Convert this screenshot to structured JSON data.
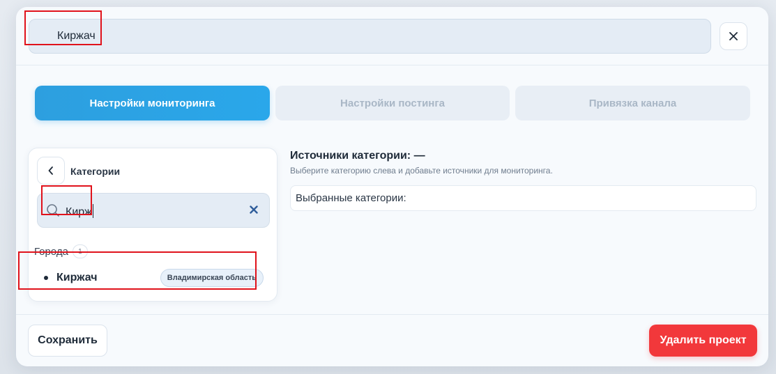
{
  "project": {
    "name": "Киржач"
  },
  "tabs": [
    {
      "label": "Настройки мониторинга",
      "active": true
    },
    {
      "label": "Настройки постинга",
      "active": false
    },
    {
      "label": "Привязка канала",
      "active": false
    }
  ],
  "categories_panel": {
    "title": "Категории",
    "search": {
      "value": "Кирж"
    },
    "group": {
      "label": "Города",
      "count": "1"
    },
    "results": [
      {
        "name": "Киржач",
        "region": "Владимирская область"
      }
    ]
  },
  "sources": {
    "title": "Источники категории: —",
    "description": "Выберите категорию слева и добавьте источники для мониторинга.",
    "selected_label": "Выбранные категории:"
  },
  "footer": {
    "save_label": "Сохранить",
    "delete_label": "Удалить проект"
  },
  "colors": {
    "accent": "#2aa7ea",
    "danger": "#f2383b",
    "highlight": "#e0121b"
  }
}
